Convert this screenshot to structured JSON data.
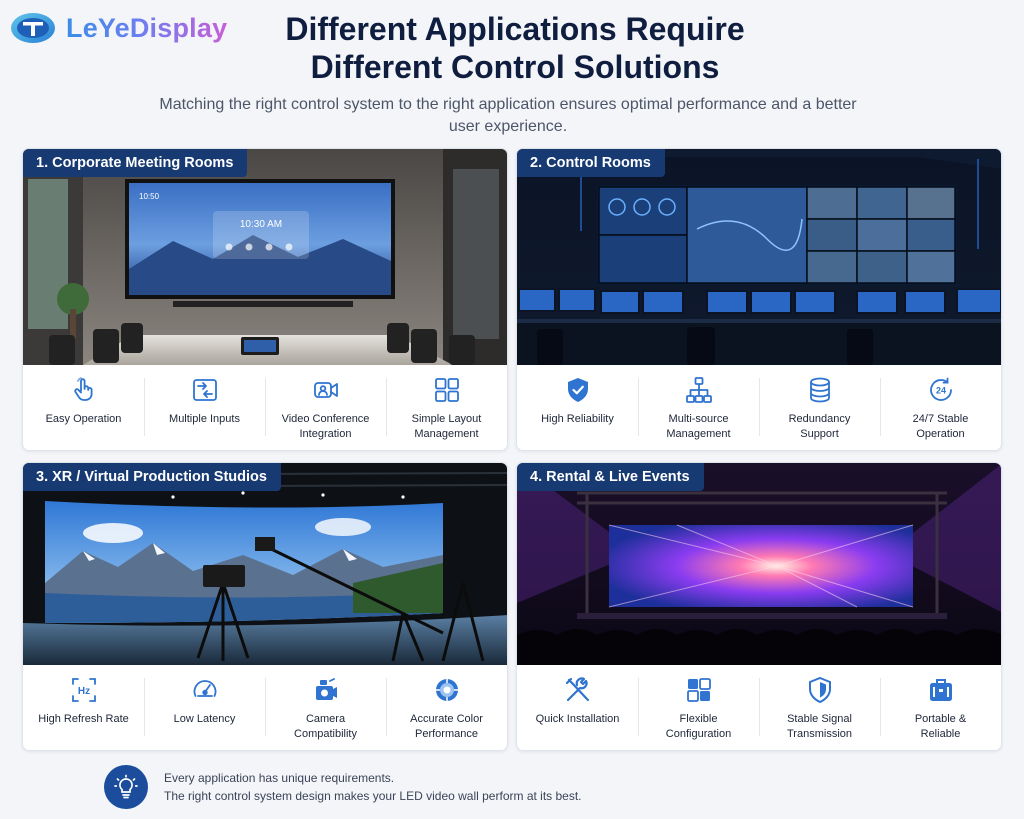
{
  "brand": {
    "name": "LeYeDisplay"
  },
  "header": {
    "title": "Different Applications Require\nDifferent Control Solutions",
    "subtitle": "Matching the right control system to the right application ensures optimal performance and a better user experience."
  },
  "colors": {
    "primary_navy": "#173a72",
    "icon_blue": "#2f74d0",
    "title_navy": "#0f1d3f",
    "background": "#f3f5f9"
  },
  "cards": [
    {
      "label": "1. Corporate Meeting Rooms",
      "screen_time": "10:30 AM",
      "screen_corner": "10:50",
      "features": [
        {
          "icon": "hand-pointer-icon",
          "label": "Easy Operation"
        },
        {
          "icon": "multiple-inputs-icon",
          "label": "Multiple Inputs"
        },
        {
          "icon": "video-conference-icon",
          "label": "Video Conference\nIntegration"
        },
        {
          "icon": "layout-grid-icon",
          "label": "Simple Layout\nManagement"
        }
      ]
    },
    {
      "label": "2. Control Rooms",
      "features": [
        {
          "icon": "shield-check-icon",
          "label": "High Reliability"
        },
        {
          "icon": "network-tree-icon",
          "label": "Multi-source\nManagement"
        },
        {
          "icon": "database-icon",
          "label": "Redundancy\nSupport"
        },
        {
          "icon": "clock-24-icon",
          "label": "24/7 Stable\nOperation"
        }
      ]
    },
    {
      "label": "3. XR / Virtual Production Studios",
      "features": [
        {
          "icon": "hz-icon",
          "label": "High Refresh Rate"
        },
        {
          "icon": "speedometer-icon",
          "label": "Low Latency"
        },
        {
          "icon": "camera-icon",
          "label": "Camera\nCompatibility"
        },
        {
          "icon": "color-wheel-icon",
          "label": "Accurate Color\nPerformance"
        }
      ]
    },
    {
      "label": "4. Rental & Live Events",
      "features": [
        {
          "icon": "tools-icon",
          "label": "Quick Installation"
        },
        {
          "icon": "modules-icon",
          "label": "Flexible\nConfiguration"
        },
        {
          "icon": "signal-shield-icon",
          "label": "Stable Signal\nTransmission"
        },
        {
          "icon": "case-icon",
          "label": "Portable &\nReliable"
        }
      ]
    }
  ],
  "footer": {
    "icon": "lightbulb-icon",
    "line1": "Every application has unique requirements.",
    "line2": "The right control system design makes your LED video wall perform at its best."
  }
}
